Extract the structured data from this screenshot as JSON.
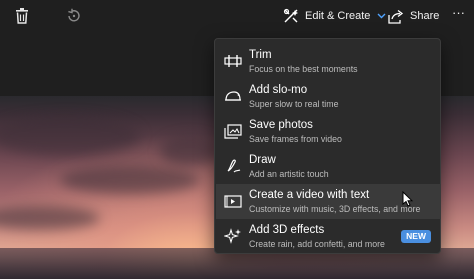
{
  "toolbar": {
    "edit_create_label": "Edit & Create",
    "share_label": "Share",
    "more_label": "···"
  },
  "menu": {
    "items": [
      {
        "title": "Trim",
        "subtitle": "Focus on the best moments",
        "icon": "trim-icon"
      },
      {
        "title": "Add slo-mo",
        "subtitle": "Super slow to real time",
        "icon": "slow-motion-icon"
      },
      {
        "title": "Save photos",
        "subtitle": "Save frames from video",
        "icon": "save-photos-icon"
      },
      {
        "title": "Draw",
        "subtitle": "Add an artistic touch",
        "icon": "draw-icon"
      },
      {
        "title": "Create a video with text",
        "subtitle": "Customize with music, 3D effects, and more",
        "icon": "video-text-icon",
        "hovered": true
      },
      {
        "title": "Add 3D effects",
        "subtitle": "Create rain, add confetti, and more",
        "icon": "sparkle-icon",
        "badge": "NEW"
      }
    ]
  },
  "colors": {
    "background": "#1f1f1f",
    "menu_background": "#2b2b2b",
    "menu_hover": "#3a3a3a",
    "badge": "#4a8fe0"
  }
}
